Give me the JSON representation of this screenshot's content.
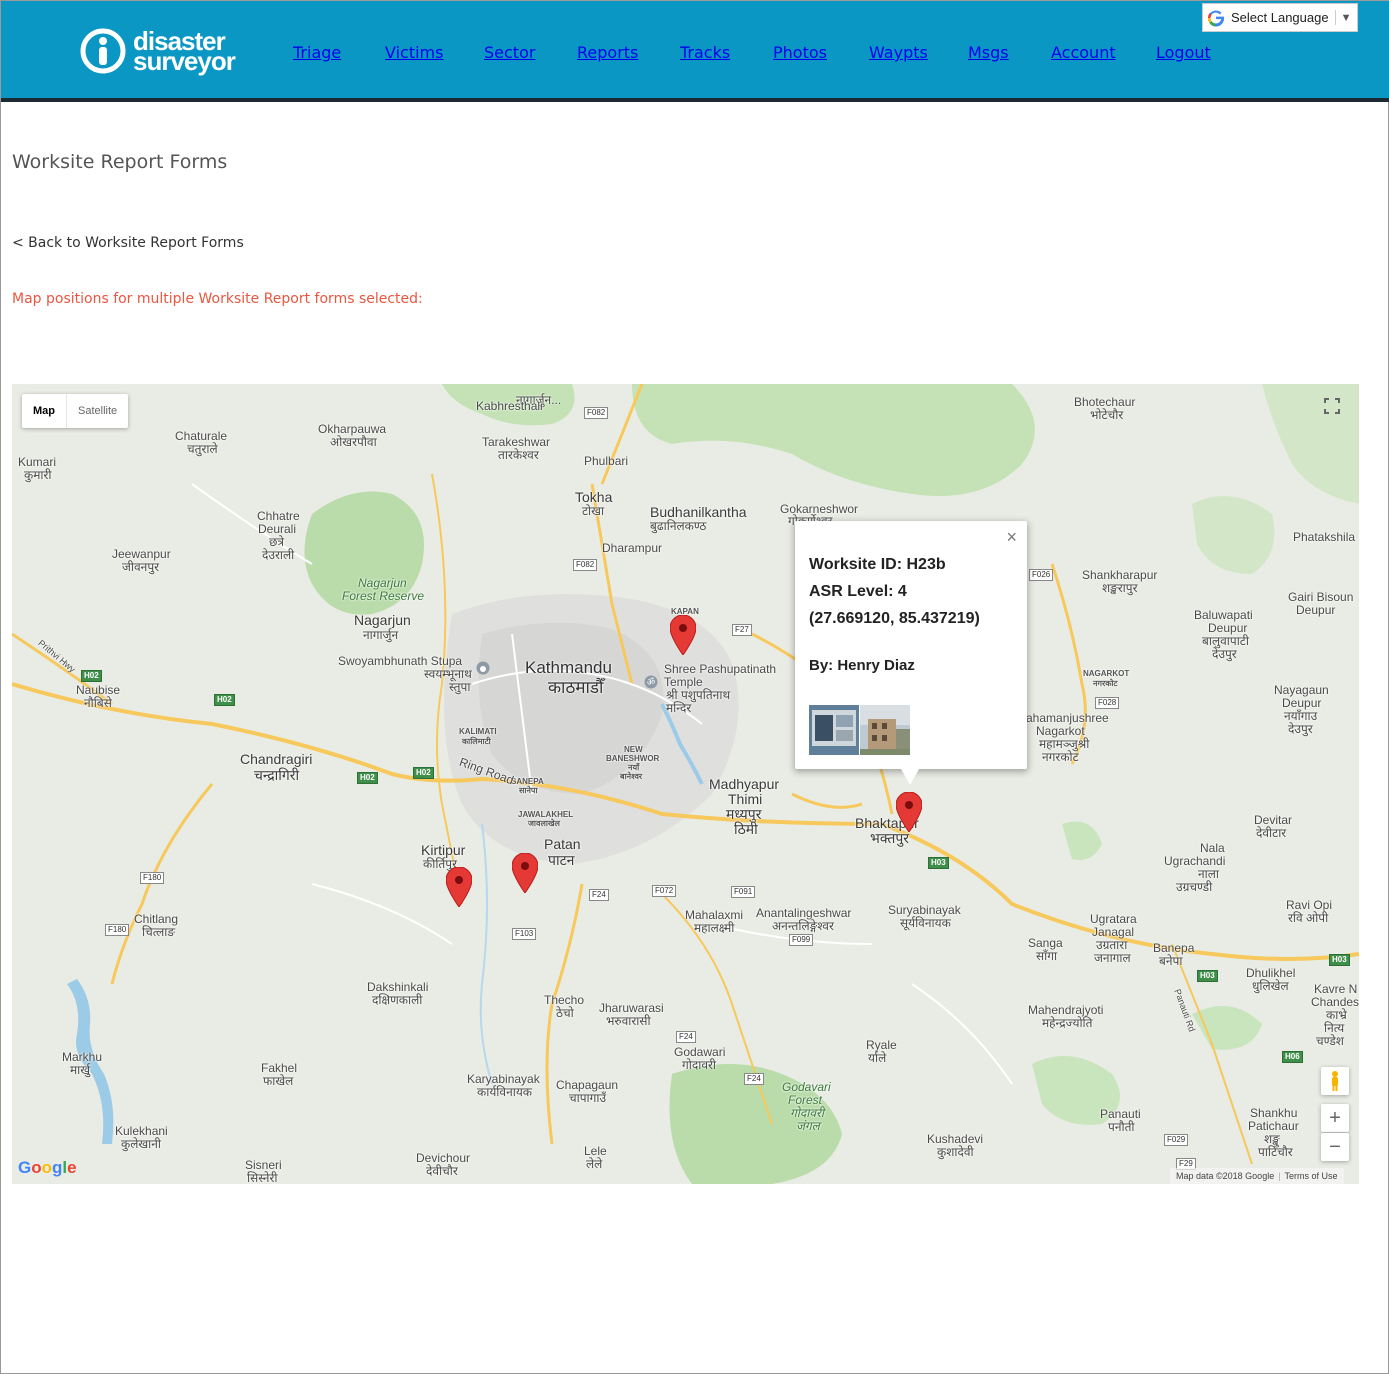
{
  "brand": {
    "line1": "disaster",
    "line2": "surveyor"
  },
  "nav": [
    "Triage",
    "Victims",
    "Sector",
    "Reports",
    "Tracks",
    "Photos",
    "Waypts",
    "Msgs",
    "Account",
    "Logout"
  ],
  "language": {
    "label": "Select Language",
    "arrow": "▼"
  },
  "page": {
    "title": "Worksite Report Forms",
    "back_link": "< Back to Worksite Report Forms",
    "note": "Map positions for multiple Worksite Report forms selected:"
  },
  "map": {
    "type_map": "Map",
    "type_satellite": "Satellite",
    "zoom_in": "+",
    "zoom_out": "−",
    "google": "Google",
    "attribution": "Map data ©2018 Google",
    "terms": "Terms of Use",
    "colors": {
      "land": "#e9ece4",
      "forest": "#b9dcaa",
      "water": "#9ccbe8",
      "road": "#f7c85c",
      "pin": "#e53935"
    },
    "labels": {
      "kathmandu": "Kathmandu",
      "kathmandu_np": "काठमाडौँ",
      "patan": "Patan",
      "patan_np": "पाटन",
      "bhaktapur": "Bhaktapur",
      "bhaktapur_np": "भक्तपुर",
      "madhyapur": "Madhyapur",
      "thimi": "Thimi",
      "madhyapur_np": "मध्यपुर",
      "thimi_np": "ठिमी",
      "nagarjun": "Nagarjun",
      "nagarjun_np": "नागार्जुन",
      "forest_reserve": "Nagarjun\nForest Reserve",
      "chandragiri": "Chandragiri",
      "chandragiri_np": "चन्द्रागिरी",
      "kirtipur": "Kirtipur",
      "kirtipur_np": "कीर्तिपुर",
      "tokha": "Tokha",
      "tokha_np": "टोखा",
      "budhanilkantha": "Budhanilkantha",
      "budhanilkantha_np": "बुढानिलकण्ठ",
      "dharampur": "Dharampur",
      "phulbari": "Phulbari",
      "kabhresthali": "Kabhresthali",
      "tarakeshwar": "Tarakeshwar",
      "tarakeshwar_np": "तारकेश्वर",
      "okharpauwa": "Okharpauwa",
      "okharpauwa_np": "ओखरपौवा",
      "chaturale": "Chaturale",
      "chaturale_np": "चतुराले",
      "kumari": "Kumari",
      "kumari_np": "कुमारी",
      "chhatre": "Chhatre",
      "deurali": "Deurali",
      "chhatre_np": "छत्रे",
      "deurali_np": "देउराली",
      "jeewanpur": "Jeewanpur",
      "jeewanpur_np": "जीवनपुर",
      "naubise": "Naubise",
      "naubise_np": "नौबिसे",
      "swoyambhu": "Swoyambhunath Stupa",
      "swoyambhu_np1": "स्वयम्भूनाथ",
      "swoyambhu_np2": "स्तुपा",
      "pashupati": "Shree Pashupatinath",
      "pashupati2": "Temple",
      "pashupati_np1": "श्री पशुपतिनाथ",
      "pashupati_np2": "मन्दिर",
      "kapan": "KAPAN",
      "kalimati": "KALIMATI",
      "kalimati_np": "कालिमाटी",
      "new_baneshwor": "NEW",
      "new_baneshwor2": "BANESHWOR",
      "new_baneshwor_np": "नयाँ",
      "new_baneshwor_np2": "बानेश्वर",
      "sanepa": "SANEPA",
      "sanepa_np": "सानेपा",
      "jawalakhel": "JAWALAKHEL",
      "jawalakhel_np": "जावलाखेल",
      "ring_road": "Ring Road",
      "gokarneshwor": "Gokarneshwor",
      "gokarneshwor_np": "गोकर्णेश्वर",
      "bhotechaur": "Bhotechaur",
      "bhotechaur_np": "भोटेचौर",
      "phatakshila": "Phatakshila",
      "shankharapur": "Shankharapur",
      "shankharapur_np": "शङ्खरापुर",
      "baluwapati": "Baluwapati",
      "baluwapati2": "Deupur",
      "baluwapati_np1": "बालुवापाटी",
      "baluwapati_np2": "देउपुर",
      "gairi": "Gairi Bisoun",
      "gairi2": "Deupur",
      "nagarkot_small": "NAGARKOT",
      "nagarkot_small_np": "नगरकोट",
      "nayagaun": "Nayagaun",
      "nayagaun2": "Deupur",
      "nayagaun_np1": "नयाँगाउ",
      "nayagaun_np2": "देउपुर",
      "mahamanjushree": "ahamanjushree",
      "mahamanjushree2": "Nagarkot",
      "mahamanjushree_np1": "महामञ्जुश्री",
      "mahamanjushree_np2": "नगरकोट",
      "devitar": "Devitar",
      "devitar_np": "देवीटार",
      "nala": "Nala",
      "ugrachandi": "Ugrachandi",
      "nala_np": "नाला",
      "ugrachandi_np": "उग्रचण्डी",
      "suryabinayak": "Suryabinayak",
      "suryabinayak_np": "सूर्यविनायक",
      "ravi_opi": "Ravi Opi",
      "ravi_opi_np": "रवि ओपी",
      "ugratara": "Ugratara",
      "janagal": "Janagal",
      "ugratara_np": "उग्रतारा",
      "janagal_np": "जनागाल",
      "sanga": "Sanga",
      "sanga_np": "साँगा",
      "banepa": "Banepa",
      "banepa_np": "बनेपा",
      "dhulikhel": "Dhulikhel",
      "dhulikhel_np": "धुलिखेल",
      "kavre": "Kavre N",
      "kavre2": "Chandes",
      "kavre_np1": "काभ्रे",
      "kavre_np2": "नित्य",
      "kavre_np3": "चण्डेश",
      "mahendraiyoti": "Mahendrajyoti",
      "mahendraiyoti_np": "महेन्द्रज्योति",
      "panauti_rd": "Panauti Rd",
      "mahalaxmi": "Mahalaxmi",
      "mahalaxmi_np": "महालक्ष्मी",
      "anantalingeshwar": "Anantalingeshwar",
      "anantalingeshwar_np": "अनन्तलिङ्गेश्वर",
      "chitlang": "Chitlang",
      "chitlang_np": "चित्लाङ",
      "dakshinkali": "Dakshinkali",
      "dakshinkali_np": "दक्षिणकाली",
      "thecho": "Thecho",
      "thecho_np": "ठेचो",
      "jharuwarasi": "Jharuwarasi",
      "jharuwarasi_np": "भरुवारासी",
      "godawari": "Godawari",
      "godawari_np": "गोदावरी",
      "godavari_forest": "Godavari\nForest",
      "godavari_forest_np": "गोदावरी\nजंगल",
      "ryale": "Ryale",
      "ryale_np": "र्याले",
      "markhu": "Markhu",
      "markhu_np": "मार्खु",
      "fakhel": "Fakhel",
      "fakhel_np": "फाखेल",
      "karyabinayak": "Karyabinayak",
      "karyabinayak_np": "कार्यविनायक",
      "chapagaun": "Chapagaun",
      "chapagaun_np": "चापागाउँ",
      "kulekhani": "Kulekhani",
      "kulekhani_np": "कुलेखानी",
      "devichour": "Devichour",
      "devichour_np": "देवीचौर",
      "sisneri": "Sisneri",
      "sisneri_np": "सिस्नेरी",
      "lele": "Lele",
      "lele_np": "लेले",
      "kushadevi": "Kushadevi",
      "kushadevi_np": "कुशादेवी",
      "panauti": "Panauti",
      "panauti_np": "पनौती",
      "shankhu": "Shankhu",
      "shankhu2": "Patichaur",
      "shankhu_np1": "शङ्खु",
      "shankhu_np2": "पाटिचौर",
      "prithvi": "Prithvi Hwy",
      "nagarjun_top": "नागार्जुन..."
    },
    "shields": {
      "f082a": "F082",
      "f082b": "F082",
      "f27": "F27",
      "f026": "F026",
      "f028": "F028",
      "h02a": "H02",
      "h02b": "H02",
      "h02c": "H02",
      "h02d": "H02",
      "f180a": "F180",
      "f180b": "F180",
      "f24a": "F24",
      "f24b": "F24",
      "f24c": "F24",
      "f072": "F072",
      "f091": "F091",
      "f099": "F099",
      "f103": "F103",
      "h03a": "H03",
      "h03b": "H03",
      "h03c": "H03",
      "h06": "H06",
      "f029": "F029",
      "f29": "F29"
    }
  },
  "info_window": {
    "close": "×",
    "worksite_id": "Worksite ID: H23b",
    "asr_level": "ASR Level: 4",
    "coords": "(27.669120, 85.437219)",
    "by": "By: Henry Diaz"
  }
}
